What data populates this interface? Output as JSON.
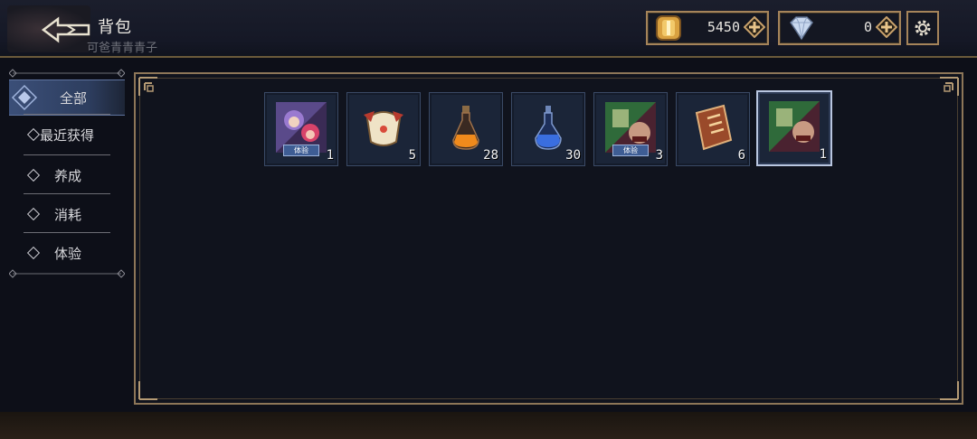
{
  "header": {
    "title": "背包",
    "subtitle": "可爸青青青子"
  },
  "currencies": {
    "gold": {
      "icon": "gold-coin-icon",
      "value": "5450"
    },
    "gem": {
      "icon": "diamond-icon",
      "value": "0"
    }
  },
  "sidebar": {
    "items": [
      {
        "label": "全部",
        "active": true
      },
      {
        "label": "最近获得",
        "active": false
      },
      {
        "label": "养成",
        "active": false
      },
      {
        "label": "消耗",
        "active": false
      },
      {
        "label": "体验",
        "active": false
      }
    ]
  },
  "inventory": {
    "slots": [
      {
        "icon": "hero-card-purple-hair-icon",
        "count": "1",
        "trial": "体验"
      },
      {
        "icon": "cloth-bundle-icon",
        "count": "5"
      },
      {
        "icon": "orange-potion-icon",
        "count": "28"
      },
      {
        "icon": "blue-potion-icon",
        "count": "30"
      },
      {
        "icon": "hero-card-goblin-icon",
        "count": "3",
        "trial": "体验"
      },
      {
        "icon": "rune-book-icon",
        "count": "6"
      },
      {
        "icon": "hero-card-goblin-icon",
        "count": "1",
        "selected": true
      }
    ]
  },
  "colors": {
    "frame_gold": "#8d7658",
    "active_tab": "#3b4f78",
    "panel_bg": "#10131d"
  }
}
